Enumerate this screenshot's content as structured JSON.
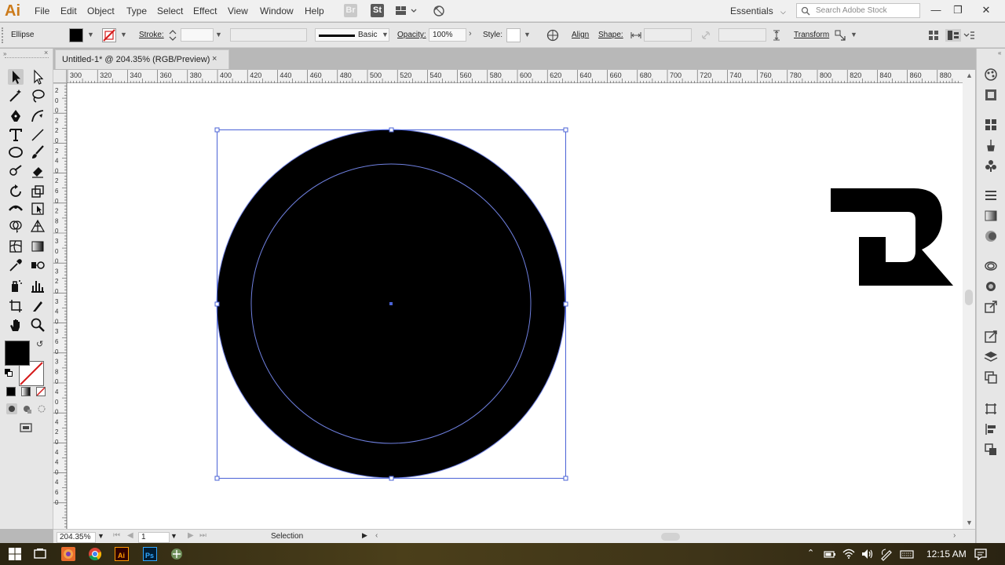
{
  "app": {
    "logo": "Ai"
  },
  "menu": [
    "File",
    "Edit",
    "Object",
    "Type",
    "Select",
    "Effect",
    "View",
    "Window",
    "Help"
  ],
  "menubar_buttons": {
    "bridge": "Br",
    "stock": "St"
  },
  "workspace": {
    "label": "Essentials"
  },
  "search": {
    "placeholder": "Search Adobe Stock"
  },
  "control_bar": {
    "selection_type": "Ellipse",
    "stroke_label": "Stroke:",
    "stroke_profile": "Basic",
    "opacity_label": "Opacity:",
    "opacity_value": "100%",
    "style_label": "Style:",
    "align_label": "Align",
    "shape_label": "Shape:",
    "transform_label": "Transform"
  },
  "document": {
    "tab_title": "Untitled-1* @ 204.35% (RGB/Preview)",
    "close": "×"
  },
  "ruler_top": [
    "300",
    "320",
    "340",
    "360",
    "380",
    "400",
    "420",
    "440",
    "460",
    "480",
    "500",
    "520",
    "540",
    "560",
    "580",
    "600",
    "620",
    "640",
    "660",
    "680",
    "700",
    "720",
    "740",
    "760",
    "780",
    "800",
    "820",
    "840",
    "860",
    "880"
  ],
  "ruler_left": [
    "2",
    "0",
    "0",
    "2",
    "2",
    "0",
    "2",
    "4",
    "0",
    "2",
    "6",
    "0",
    "2",
    "8",
    "0",
    "3",
    "0",
    "0",
    "3",
    "2",
    "0",
    "3",
    "4",
    "0",
    "3",
    "6",
    "0",
    "3",
    "8",
    "0",
    "4",
    "0",
    "0",
    "4",
    "2",
    "0",
    "4",
    "4",
    "0",
    "4",
    "6",
    "0"
  ],
  "status_bar": {
    "zoom": "204.35%",
    "artboard": "1",
    "tool": "Selection"
  },
  "colors": {
    "fill": "#000000",
    "stroke": "none",
    "selection_accent": "#4a62d6",
    "logo_accent": "#cc7b1b"
  },
  "taskbar": {
    "time": "12:15 AM"
  }
}
